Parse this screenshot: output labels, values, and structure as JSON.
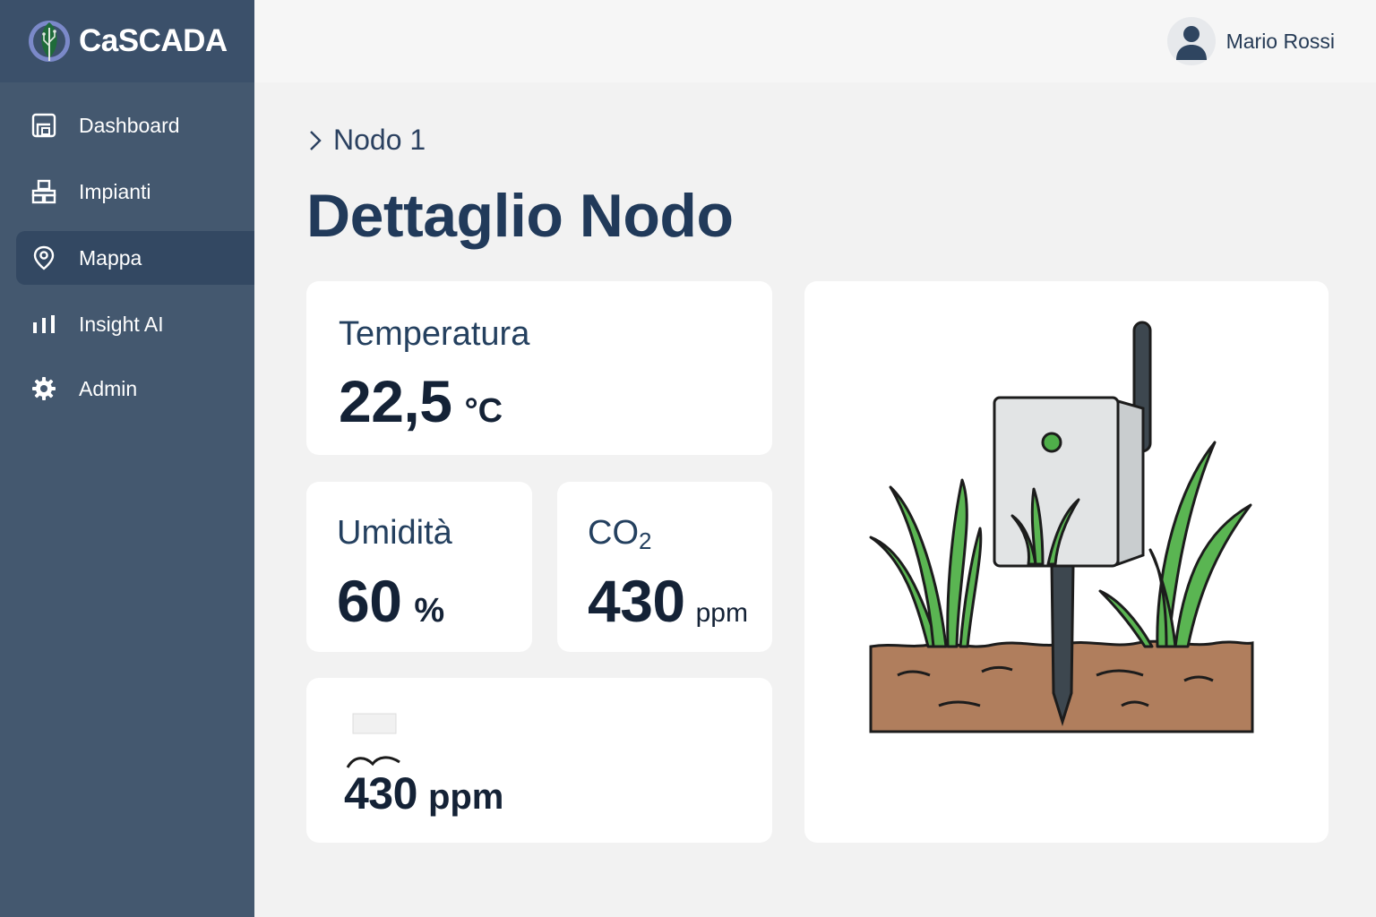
{
  "brand": {
    "name": "CaSCADA",
    "icon": "leaf-logo-icon"
  },
  "sidebar": {
    "items": [
      {
        "label": "Dashboard",
        "icon": "dashboard-icon",
        "active": false
      },
      {
        "label": "Impianti",
        "icon": "plants-icon",
        "active": false
      },
      {
        "label": "Mappa",
        "icon": "map-pin-icon",
        "active": true
      },
      {
        "label": "Insight AI",
        "icon": "bar-chart-icon",
        "active": false
      },
      {
        "label": "Admin",
        "icon": "gear-icon",
        "active": false
      }
    ]
  },
  "header": {
    "user_name": "Mario Rossi",
    "avatar_icon": "user-avatar-icon"
  },
  "breadcrumb": {
    "current": "Nodo 1"
  },
  "page": {
    "title": "Dettaglio Nodo"
  },
  "metrics": {
    "temperature": {
      "label": "Temperatura",
      "value": "22,5",
      "unit": "°C"
    },
    "humidity": {
      "label": "Umidità",
      "value": "60",
      "unit": "%"
    },
    "co2": {
      "label_main": "CO",
      "label_sub": "2",
      "value": "430",
      "unit": "ppm"
    },
    "fourth": {
      "value": "430",
      "unit": "ppm"
    }
  },
  "colors": {
    "sidebar": "#44586f",
    "sidebar_header": "#3b506a",
    "nav_active": "#334862",
    "title": "#213a5a",
    "background": "#f2f2f2",
    "plant_green": "#5ab552",
    "soil": "#b07e5d"
  }
}
